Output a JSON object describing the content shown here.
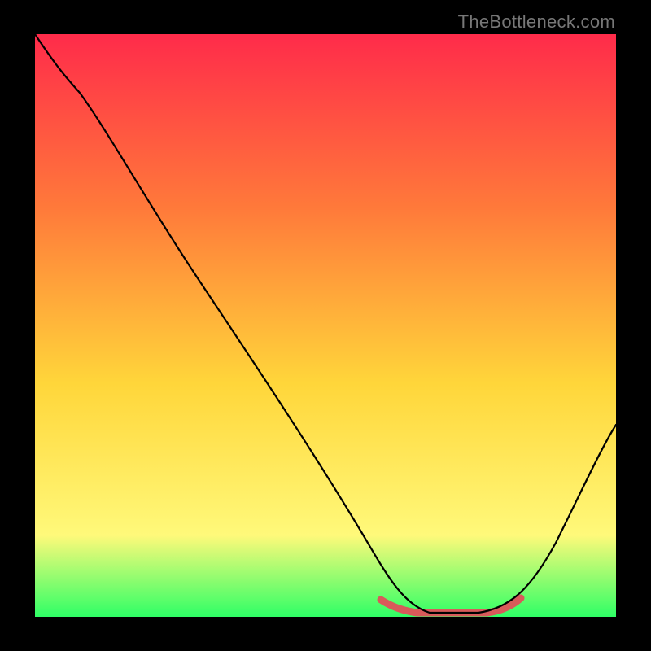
{
  "watermark": "TheBottleneck.com",
  "colors": {
    "gradient_top": "#ff2b4a",
    "gradient_mid_upper": "#ff7a3a",
    "gradient_mid": "#ffd63a",
    "gradient_lower": "#fff97a",
    "gradient_bottom": "#2fff66",
    "curve_stroke": "#000000",
    "highlight_stroke": "#d85a5a",
    "frame": "#000000"
  },
  "chart_data": {
    "type": "line",
    "title": "",
    "xlabel": "",
    "ylabel": "",
    "xlim": [
      0,
      100
    ],
    "ylim": [
      0,
      100
    ],
    "x": [
      5,
      8,
      12,
      20,
      30,
      40,
      50,
      60,
      64,
      68,
      72,
      76,
      80,
      84,
      88,
      92,
      96,
      100
    ],
    "values": [
      100,
      95,
      90,
      78,
      63,
      48,
      34,
      19,
      13,
      7,
      2,
      0,
      0,
      0,
      3,
      10,
      20,
      33
    ],
    "highlight_range_x": [
      64,
      85
    ],
    "annotations": []
  }
}
